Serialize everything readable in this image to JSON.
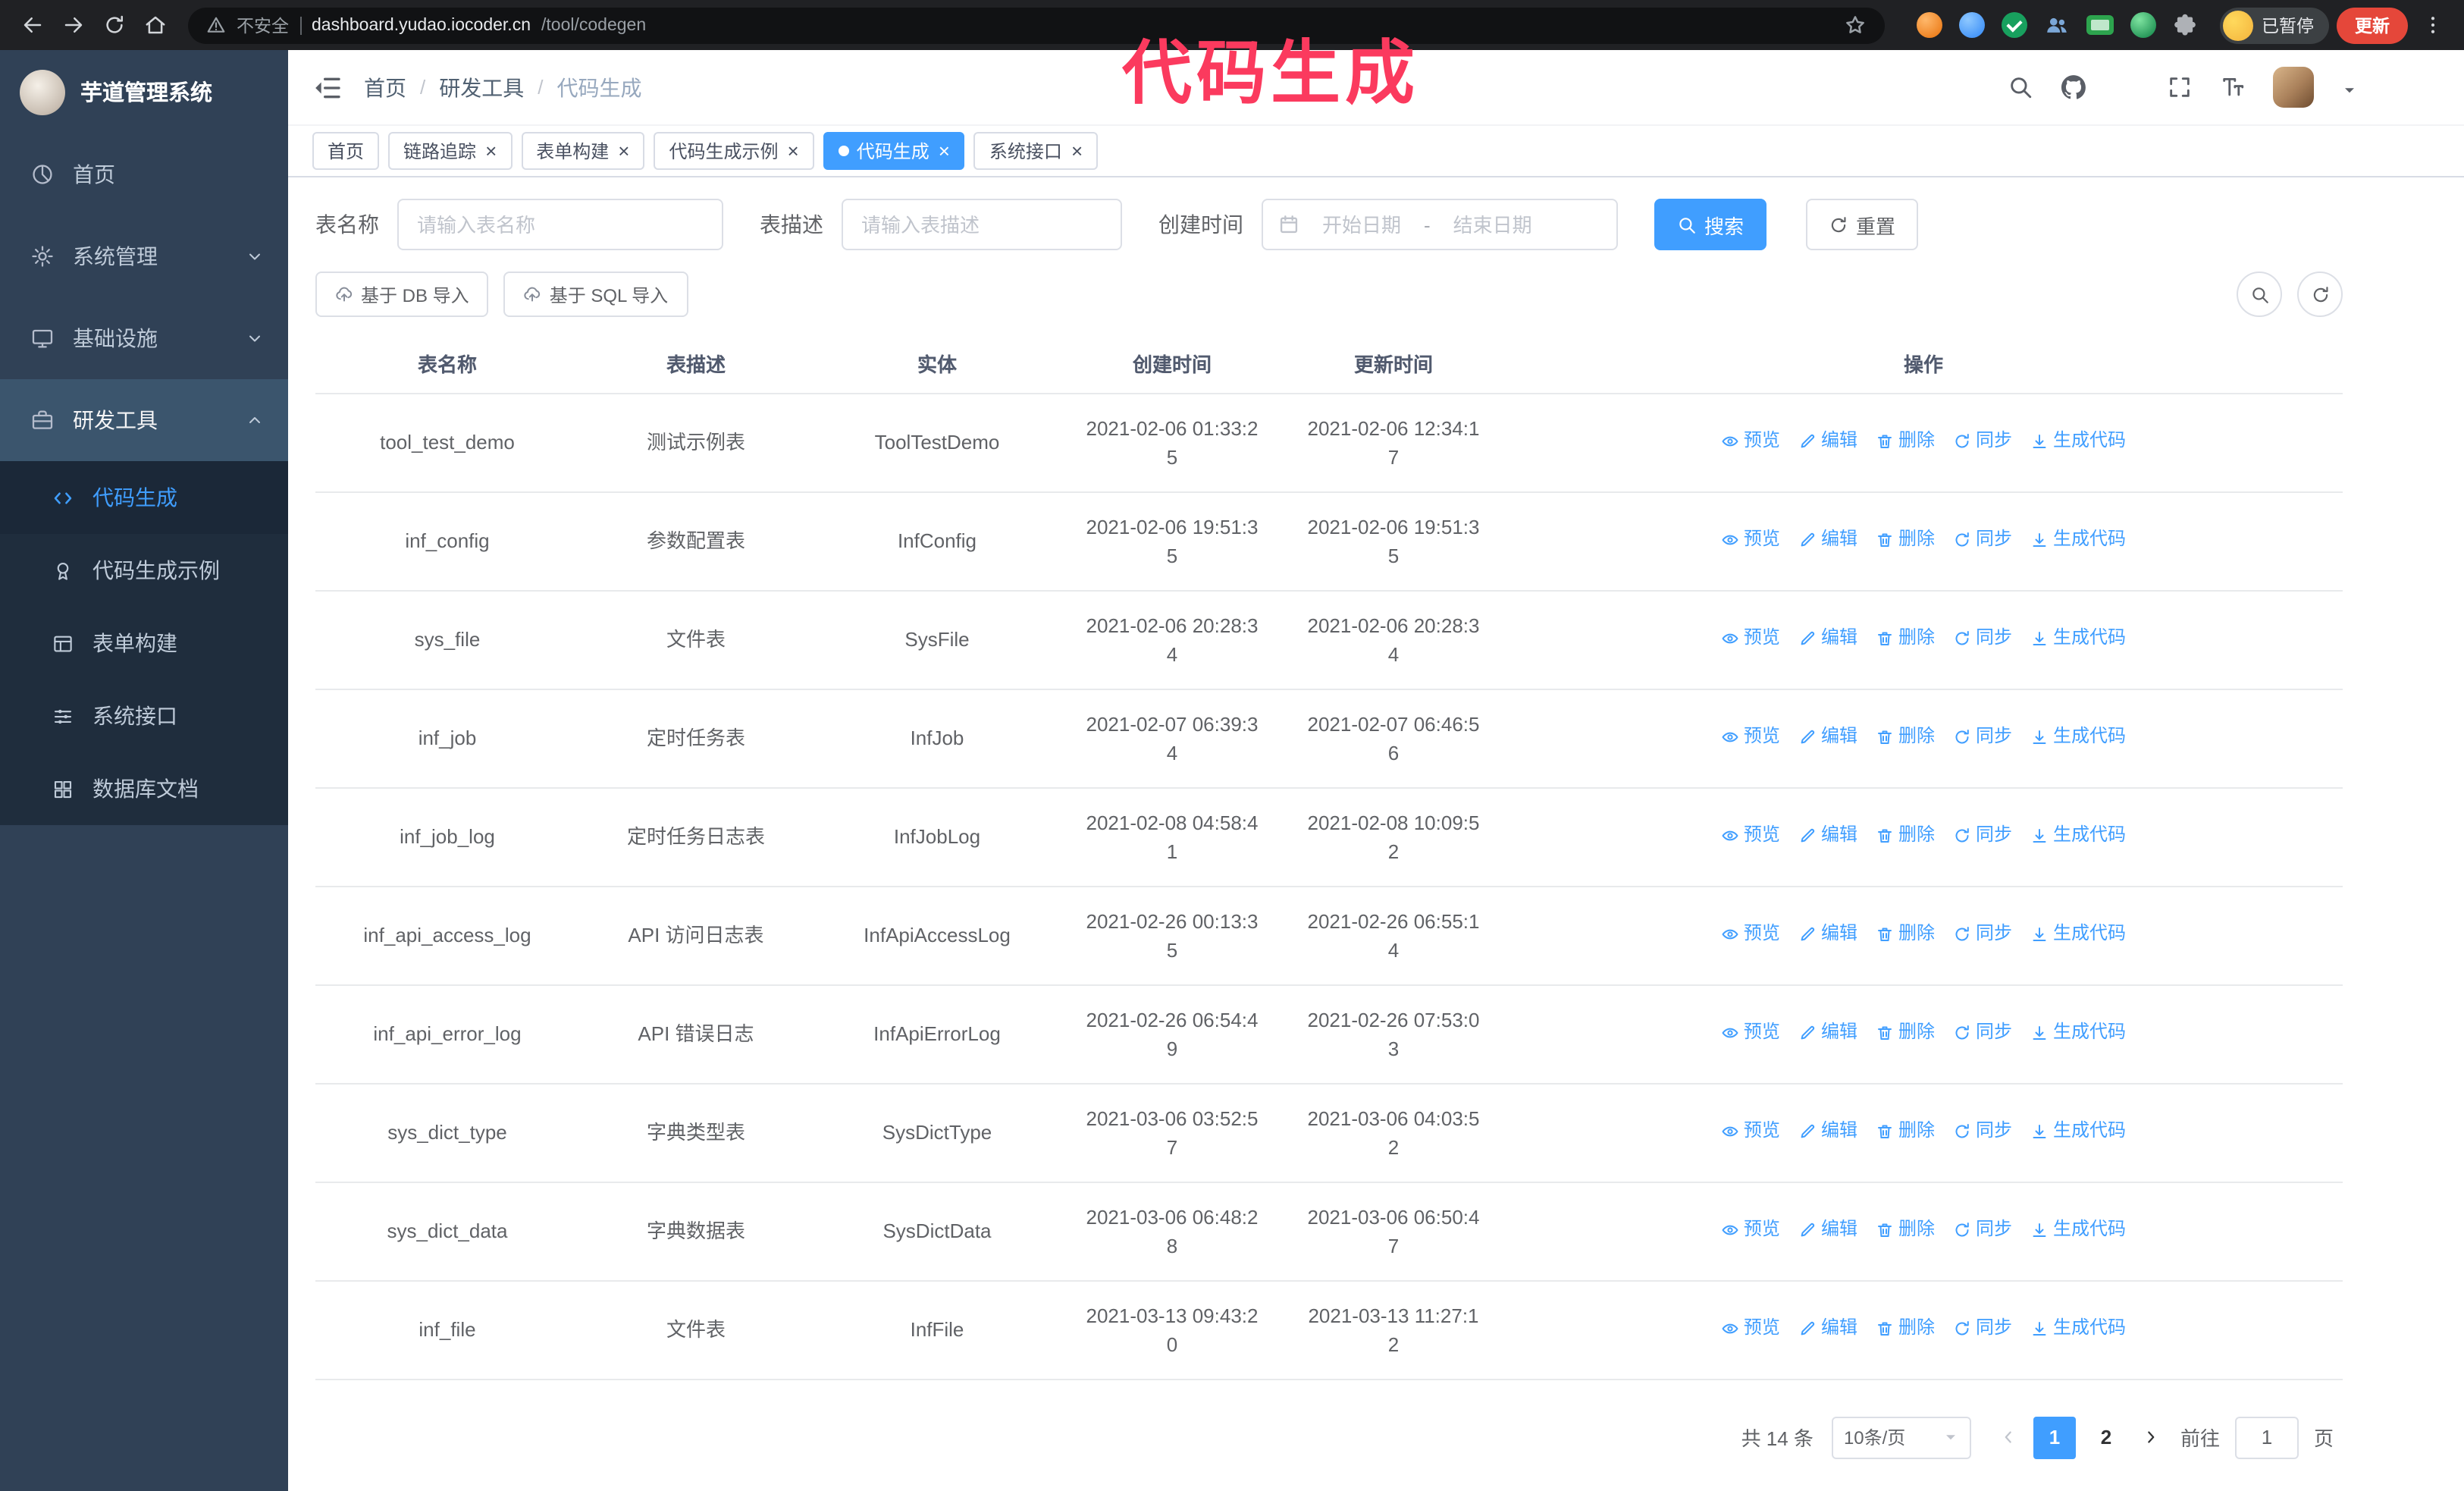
{
  "browser": {
    "warning_label": "不安全",
    "url_host": "dashboard.yudao.iocoder.cn",
    "url_path": "/tool/codegen",
    "paused_badge": "已暂停",
    "update_button": "更新"
  },
  "annotation": {
    "text": "代码生成",
    "color": "#fb3a5e"
  },
  "ui": {
    "tab_close_glyph": "×"
  },
  "sidebar": {
    "title": "芋道管理系统",
    "items": [
      {
        "label": "首页",
        "icon": "dashboard-icon",
        "expandable": false,
        "expanded": false
      },
      {
        "label": "系统管理",
        "icon": "gear-icon",
        "expandable": true,
        "expanded": false
      },
      {
        "label": "基础设施",
        "icon": "monitor-icon",
        "expandable": true,
        "expanded": false
      },
      {
        "label": "研发工具",
        "icon": "toolbox-icon",
        "expandable": true,
        "expanded": true
      }
    ],
    "subitems": [
      {
        "label": "代码生成",
        "icon": "code-icon",
        "active": true
      },
      {
        "label": "代码生成示例",
        "icon": "example-icon",
        "active": false
      },
      {
        "label": "表单构建",
        "icon": "form-icon",
        "active": false
      },
      {
        "label": "系统接口",
        "icon": "api-icon",
        "active": false
      },
      {
        "label": "数据库文档",
        "icon": "database-icon",
        "active": false
      }
    ]
  },
  "breadcrumb": {
    "separator": "/",
    "items": [
      "首页",
      "研发工具",
      "代码生成"
    ]
  },
  "tabs": [
    {
      "label": "首页",
      "closable": false,
      "active": false
    },
    {
      "label": "链路追踪",
      "closable": true,
      "active": false
    },
    {
      "label": "表单构建",
      "closable": true,
      "active": false
    },
    {
      "label": "代码生成示例",
      "closable": true,
      "active": false
    },
    {
      "label": "代码生成",
      "closable": true,
      "active": true
    },
    {
      "label": "系统接口",
      "closable": true,
      "active": false
    }
  ],
  "filters": {
    "table_name_label": "表名称",
    "table_name_placeholder": "请输入表名称",
    "table_desc_label": "表描述",
    "table_desc_placeholder": "请输入表描述",
    "create_time_label": "创建时间",
    "date_start_placeholder": "开始日期",
    "date_separator": "-",
    "date_end_placeholder": "结束日期",
    "search_button": "搜索",
    "reset_button": "重置"
  },
  "toolbar": {
    "import_db_button": "基于 DB 导入",
    "import_sql_button": "基于 SQL 导入"
  },
  "table": {
    "columns": [
      "表名称",
      "表描述",
      "实体",
      "创建时间",
      "更新时间",
      "操作"
    ],
    "actions": [
      {
        "label": "预览",
        "icon": "eye-icon",
        "name": "preview-link"
      },
      {
        "label": "编辑",
        "icon": "edit-icon",
        "name": "edit-link"
      },
      {
        "label": "删除",
        "icon": "delete-icon",
        "name": "delete-link"
      },
      {
        "label": "同步",
        "icon": "sync-icon",
        "name": "sync-link"
      },
      {
        "label": "生成代码",
        "icon": "download-icon",
        "name": "generate-code-link"
      }
    ],
    "rows": [
      {
        "name": "tool_test_demo",
        "desc": "测试示例表",
        "entity": "ToolTestDemo",
        "created": "2021-02-06 01:33:25",
        "updated": "2021-02-06 12:34:17"
      },
      {
        "name": "inf_config",
        "desc": "参数配置表",
        "entity": "InfConfig",
        "created": "2021-02-06 19:51:35",
        "updated": "2021-02-06 19:51:35"
      },
      {
        "name": "sys_file",
        "desc": "文件表",
        "entity": "SysFile",
        "created": "2021-02-06 20:28:34",
        "updated": "2021-02-06 20:28:34"
      },
      {
        "name": "inf_job",
        "desc": "定时任务表",
        "entity": "InfJob",
        "created": "2021-02-07 06:39:34",
        "updated": "2021-02-07 06:46:56"
      },
      {
        "name": "inf_job_log",
        "desc": "定时任务日志表",
        "entity": "InfJobLog",
        "created": "2021-02-08 04:58:41",
        "updated": "2021-02-08 10:09:52"
      },
      {
        "name": "inf_api_access_log",
        "desc": "API 访问日志表",
        "entity": "InfApiAccessLog",
        "created": "2021-02-26 00:13:35",
        "updated": "2021-02-26 06:55:14"
      },
      {
        "name": "inf_api_error_log",
        "desc": "API 错误日志",
        "entity": "InfApiErrorLog",
        "created": "2021-02-26 06:54:49",
        "updated": "2021-02-26 07:53:03"
      },
      {
        "name": "sys_dict_type",
        "desc": "字典类型表",
        "entity": "SysDictType",
        "created": "2021-03-06 03:52:57",
        "updated": "2021-03-06 04:03:52"
      },
      {
        "name": "sys_dict_data",
        "desc": "字典数据表",
        "entity": "SysDictData",
        "created": "2021-03-06 06:48:28",
        "updated": "2021-03-06 06:50:47"
      },
      {
        "name": "inf_file",
        "desc": "文件表",
        "entity": "InfFile",
        "created": "2021-03-13 09:43:20",
        "updated": "2021-03-13 11:27:12"
      }
    ]
  },
  "pagination": {
    "total_label": "共 14 条",
    "page_size_value": "10条/页",
    "pages": [
      "1",
      "2"
    ],
    "active_page": "1",
    "goto_label": "前往",
    "goto_value": "1",
    "page_unit_label": "页"
  },
  "colors": {
    "primary": "#409eff",
    "sidebar_bg": "#304156",
    "submenu_bg": "#1f2d3d",
    "chrome_bg": "#202124",
    "update_button_bg": "#e5473a",
    "annotation": "#fb3a5e"
  }
}
